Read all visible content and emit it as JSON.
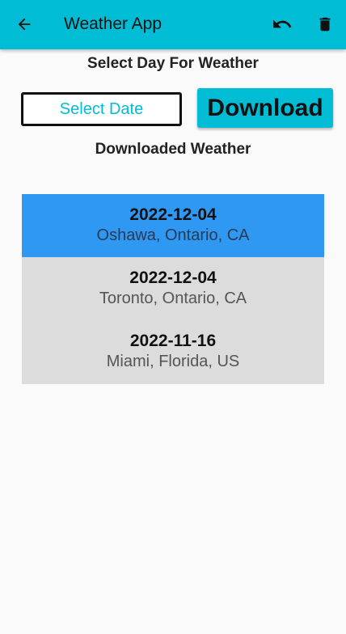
{
  "app_bar": {
    "title": "Weather App",
    "back_icon": "arrow-left-icon",
    "undo_icon": "undo-icon",
    "delete_icon": "trash-icon",
    "background_color": "#00bcd4"
  },
  "main": {
    "select_day_heading": "Select Day For Weather",
    "select_date_label": "Select Date",
    "download_label": "Download",
    "downloaded_heading": "Downloaded Weather"
  },
  "downloads": [
    {
      "date": "2022-12-04",
      "location": "Oshawa, Ontario, CA",
      "selected": true
    },
    {
      "date": "2022-12-04",
      "location": "Toronto, Ontario, CA",
      "selected": false
    },
    {
      "date": "2022-11-16",
      "location": "Miami, Florida, US",
      "selected": false
    }
  ],
  "colors": {
    "accent": "#00bcd4",
    "selected_row": "#2f98f3",
    "list_background": "#dcdcdc"
  }
}
